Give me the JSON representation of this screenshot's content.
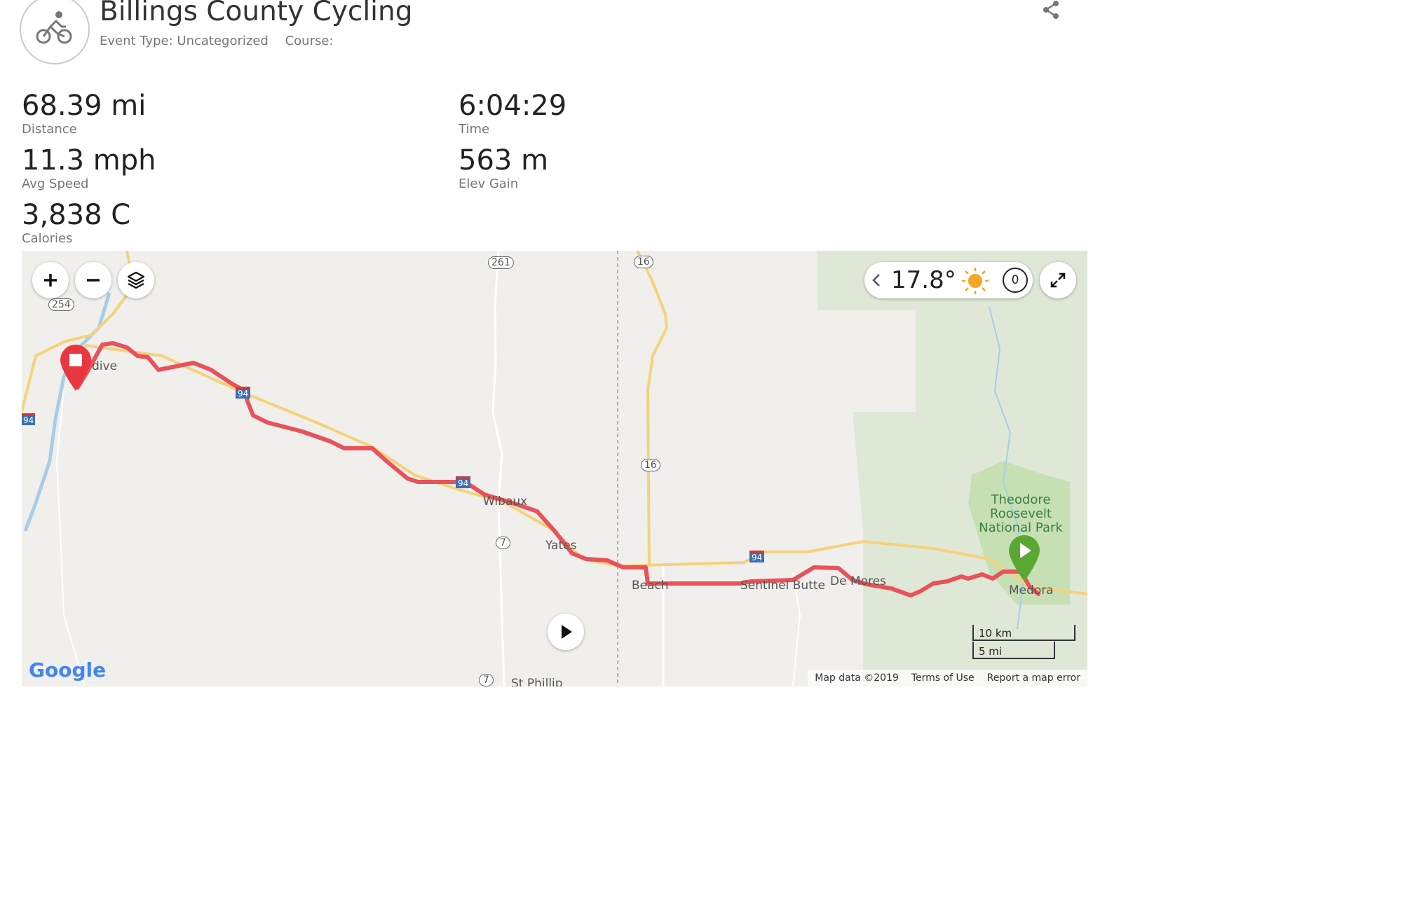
{
  "activity": {
    "title": "Billings County Cycling",
    "event_type": "Event Type: Uncategorized",
    "course": "Course:"
  },
  "stats": {
    "distance": {
      "value": "68.39 mi",
      "label": "Distance"
    },
    "time": {
      "value": "6:04:29",
      "label": "Time"
    },
    "avg_speed": {
      "value": "11.3 mph",
      "label": "Avg Speed"
    },
    "elev_gain": {
      "value": "563 m",
      "label": "Elev Gain"
    },
    "calories": {
      "value": "3,838 C",
      "label": "Calories"
    }
  },
  "map": {
    "weather": {
      "temperature": "17.8°",
      "wind": "0"
    },
    "places": {
      "glendive": "dive",
      "wibaux": "Wibaux",
      "yates": "Yates",
      "beach": "Beach",
      "sentinel_butte": "Sentinel Butte",
      "de_mores": "De Mores",
      "medora": "Medora",
      "st_phillip": "St Phillip"
    },
    "park_name": "Theodore Roosevelt National Park",
    "highway_shields": {
      "h261": "261",
      "h254": "254",
      "h16a": "16",
      "h16b": "16",
      "h7a": "7",
      "h7b": "7",
      "i94a": "94",
      "i94b": "94",
      "i94c": "94",
      "i94d": "94"
    },
    "scale": {
      "km": "10 km",
      "mi": "5 mi"
    },
    "attribution": {
      "map_data": "Map data ©2019",
      "terms": "Terms of Use",
      "report": "Report a map error"
    },
    "google_logo": "Google",
    "colors": {
      "route": "#e8525a",
      "start_pin": "#5aa832",
      "end_pin": "#e8373f",
      "highway": "#f5d27a"
    }
  }
}
